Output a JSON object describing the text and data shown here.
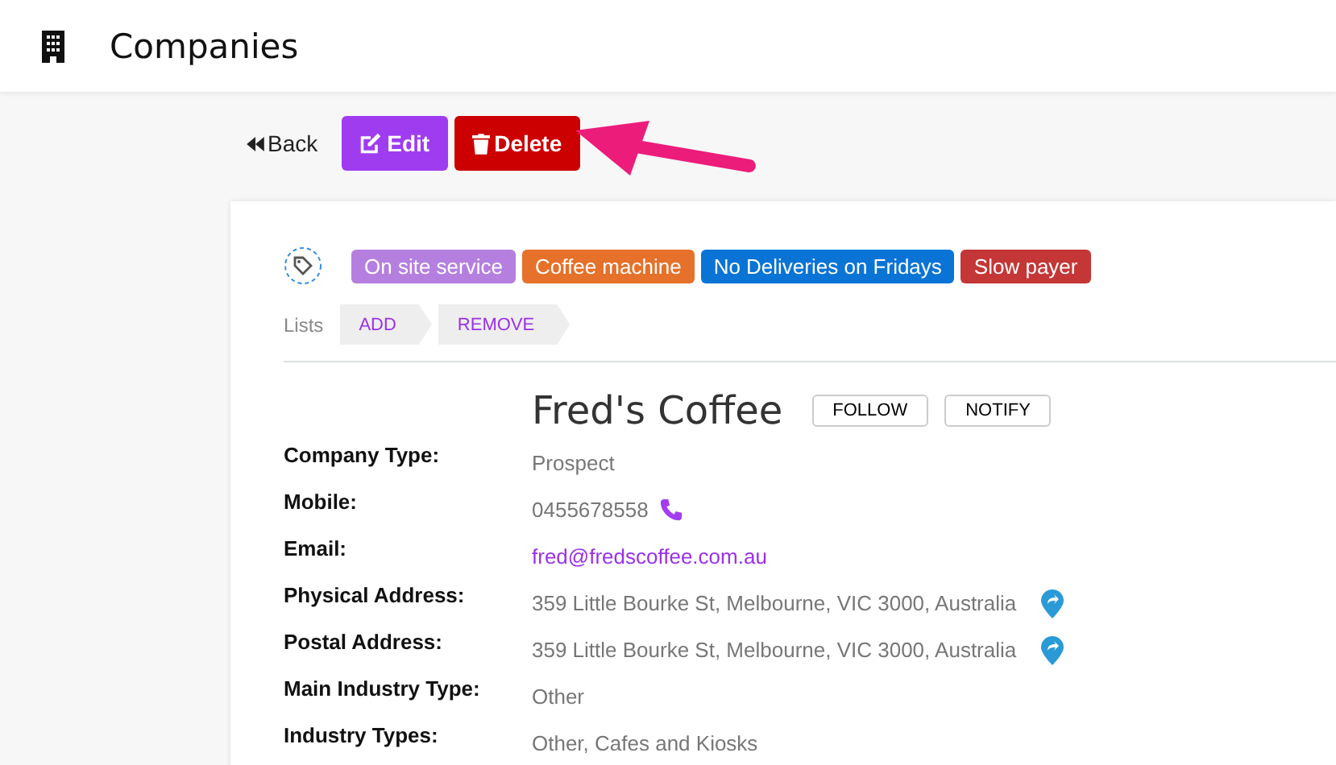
{
  "header": {
    "title": "Companies"
  },
  "actions": {
    "back": "Back",
    "edit": "Edit",
    "delete": "Delete"
  },
  "tags": [
    {
      "label": "On site service",
      "color": "#b57fe0"
    },
    {
      "label": "Coffee machine",
      "color": "#e5712a"
    },
    {
      "label": "No Deliveries on Fridays",
      "color": "#0a74d6"
    },
    {
      "label": "Slow payer",
      "color": "#c53636"
    }
  ],
  "lists": {
    "label": "Lists",
    "steps": [
      "ADD",
      "REMOVE"
    ]
  },
  "company": {
    "name": "Fred's Coffee",
    "buttons": [
      "FOLLOW",
      "NOTIFY"
    ]
  },
  "fields": [
    {
      "label": "Company Type:",
      "value": "Prospect",
      "kind": "text"
    },
    {
      "label": "Mobile:",
      "value": "0455678558",
      "kind": "phone"
    },
    {
      "label": "Email:",
      "value": "fred@fredscoffee.com.au",
      "kind": "email"
    },
    {
      "label": "Physical Address:",
      "value": "359 Little Bourke St, Melbourne, VIC 3000, Australia",
      "kind": "address"
    },
    {
      "label": "Postal Address:",
      "value": "359 Little Bourke St, Melbourne, VIC 3000, Australia",
      "kind": "address"
    },
    {
      "label": "Main Industry Type:",
      "value": "Other",
      "kind": "text"
    },
    {
      "label": "Industry Types:",
      "value": "Other, Cafes and Kiosks",
      "kind": "text"
    }
  ]
}
